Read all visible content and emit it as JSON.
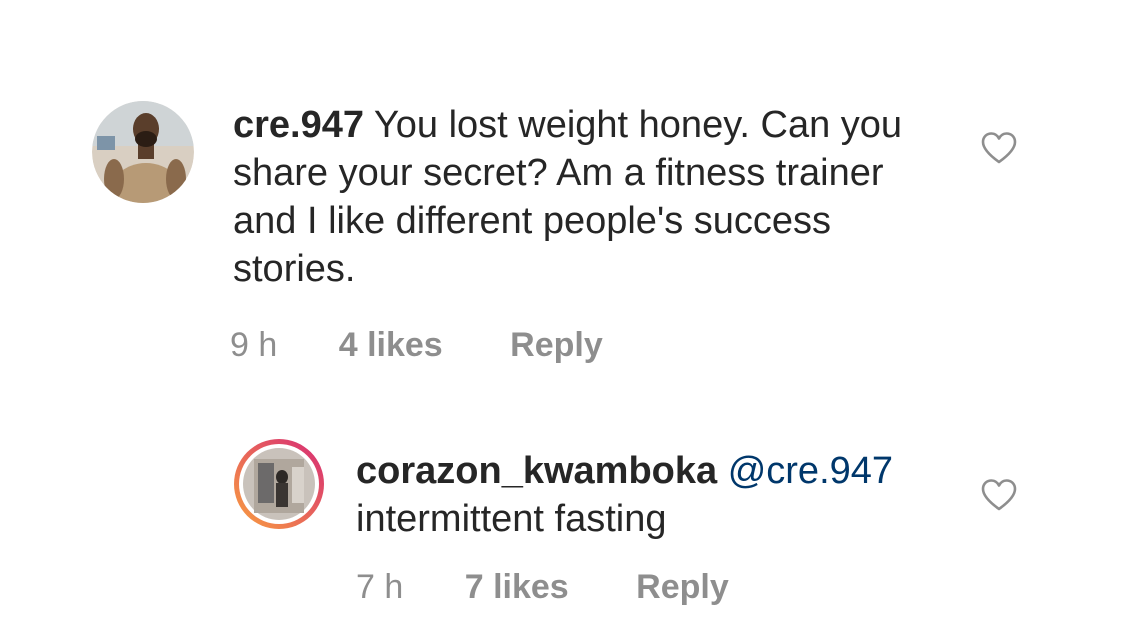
{
  "comments": [
    {
      "username": "cre.947",
      "text": "You lost weight honey. Can you share your secret? Am a fitness trainer and I like different people's success stories.",
      "time": "9 h",
      "likes": "4 likes",
      "reply_label": "Reply",
      "avatar_icon": "user-avatar",
      "like_icon": "heart-outline-icon"
    },
    {
      "username": "corazon_kwamboka",
      "mention": "@cre.947",
      "text": "intermittent fasting",
      "time": "7 h",
      "likes": "7 likes",
      "reply_label": "Reply",
      "avatar_icon": "user-avatar-story-ring",
      "like_icon": "heart-outline-icon"
    }
  ],
  "colors": {
    "text": "#262626",
    "meta": "#8e8e8e",
    "mention": "#00376b",
    "story_ring_start": "#f9a03f",
    "story_ring_end": "#d62976"
  }
}
